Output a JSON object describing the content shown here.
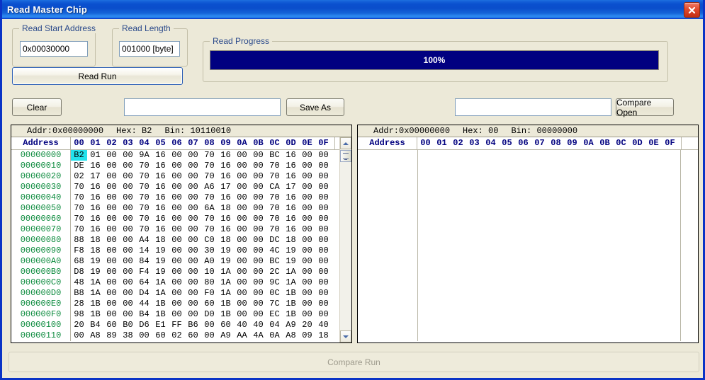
{
  "window": {
    "title": "Read Master Chip",
    "close_icon": "close-icon",
    "accent_color": "#0a50cf",
    "face_color": "#ece9d8"
  },
  "read_start_address": {
    "label": "Read Start Address",
    "value": "0x00030000",
    "placeholder": ""
  },
  "read_length": {
    "label": "Read Length",
    "value": "001000 [byte]",
    "placeholder": ""
  },
  "read_run_button": {
    "label": "Read Run"
  },
  "read_progress": {
    "label": "Read Progress",
    "percent_text": "100%",
    "percent": 100,
    "fill_color": "#000080"
  },
  "toolbar": {
    "clear_label": "Clear",
    "save_path_value": "",
    "save_path_placeholder": "",
    "save_as_label": "Save As",
    "compare_path_value": "",
    "compare_path_placeholder": "",
    "compare_open_label": "Compare Open"
  },
  "left_panel": {
    "status": {
      "addr_label": "Addr:",
      "addr_value": "0x00000000",
      "hex_label": "Hex:",
      "hex_value": "B2",
      "bin_label": "Bin:",
      "bin_value": "10110010"
    },
    "address_header": "Address",
    "byte_columns": [
      "00",
      "01",
      "02",
      "03",
      "04",
      "05",
      "06",
      "07",
      "08",
      "09",
      "0A",
      "0B",
      "0C",
      "0D",
      "0E",
      "0F"
    ],
    "selected_cell": {
      "row": 0,
      "col": 0
    },
    "rows": [
      {
        "address": "00000000",
        "bytes": [
          "B2",
          "01",
          "00",
          "00",
          "9A",
          "16",
          "00",
          "00",
          "70",
          "16",
          "00",
          "00",
          "BC",
          "16",
          "00",
          "00"
        ]
      },
      {
        "address": "00000010",
        "bytes": [
          "DE",
          "16",
          "00",
          "00",
          "70",
          "16",
          "00",
          "00",
          "70",
          "16",
          "00",
          "00",
          "70",
          "16",
          "00",
          "00"
        ]
      },
      {
        "address": "00000020",
        "bytes": [
          "02",
          "17",
          "00",
          "00",
          "70",
          "16",
          "00",
          "00",
          "70",
          "16",
          "00",
          "00",
          "70",
          "16",
          "00",
          "00"
        ]
      },
      {
        "address": "00000030",
        "bytes": [
          "70",
          "16",
          "00",
          "00",
          "70",
          "16",
          "00",
          "00",
          "A6",
          "17",
          "00",
          "00",
          "CA",
          "17",
          "00",
          "00"
        ]
      },
      {
        "address": "00000040",
        "bytes": [
          "70",
          "16",
          "00",
          "00",
          "70",
          "16",
          "00",
          "00",
          "70",
          "16",
          "00",
          "00",
          "70",
          "16",
          "00",
          "00"
        ]
      },
      {
        "address": "00000050",
        "bytes": [
          "70",
          "16",
          "00",
          "00",
          "70",
          "16",
          "00",
          "00",
          "6A",
          "18",
          "00",
          "00",
          "70",
          "16",
          "00",
          "00"
        ]
      },
      {
        "address": "00000060",
        "bytes": [
          "70",
          "16",
          "00",
          "00",
          "70",
          "16",
          "00",
          "00",
          "70",
          "16",
          "00",
          "00",
          "70",
          "16",
          "00",
          "00"
        ]
      },
      {
        "address": "00000070",
        "bytes": [
          "70",
          "16",
          "00",
          "00",
          "70",
          "16",
          "00",
          "00",
          "70",
          "16",
          "00",
          "00",
          "70",
          "16",
          "00",
          "00"
        ]
      },
      {
        "address": "00000080",
        "bytes": [
          "88",
          "18",
          "00",
          "00",
          "A4",
          "18",
          "00",
          "00",
          "C0",
          "18",
          "00",
          "00",
          "DC",
          "18",
          "00",
          "00"
        ]
      },
      {
        "address": "00000090",
        "bytes": [
          "F8",
          "18",
          "00",
          "00",
          "14",
          "19",
          "00",
          "00",
          "30",
          "19",
          "00",
          "00",
          "4C",
          "19",
          "00",
          "00"
        ]
      },
      {
        "address": "000000A0",
        "bytes": [
          "68",
          "19",
          "00",
          "00",
          "84",
          "19",
          "00",
          "00",
          "A0",
          "19",
          "00",
          "00",
          "BC",
          "19",
          "00",
          "00"
        ]
      },
      {
        "address": "000000B0",
        "bytes": [
          "D8",
          "19",
          "00",
          "00",
          "F4",
          "19",
          "00",
          "00",
          "10",
          "1A",
          "00",
          "00",
          "2C",
          "1A",
          "00",
          "00"
        ]
      },
      {
        "address": "000000C0",
        "bytes": [
          "48",
          "1A",
          "00",
          "00",
          "64",
          "1A",
          "00",
          "00",
          "80",
          "1A",
          "00",
          "00",
          "9C",
          "1A",
          "00",
          "00"
        ]
      },
      {
        "address": "000000D0",
        "bytes": [
          "B8",
          "1A",
          "00",
          "00",
          "D4",
          "1A",
          "00",
          "00",
          "F0",
          "1A",
          "00",
          "00",
          "0C",
          "1B",
          "00",
          "00"
        ]
      },
      {
        "address": "000000E0",
        "bytes": [
          "28",
          "1B",
          "00",
          "00",
          "44",
          "1B",
          "00",
          "00",
          "60",
          "1B",
          "00",
          "00",
          "7C",
          "1B",
          "00",
          "00"
        ]
      },
      {
        "address": "000000F0",
        "bytes": [
          "98",
          "1B",
          "00",
          "00",
          "B4",
          "1B",
          "00",
          "00",
          "D0",
          "1B",
          "00",
          "00",
          "EC",
          "1B",
          "00",
          "00"
        ]
      },
      {
        "address": "00000100",
        "bytes": [
          "20",
          "B4",
          "60",
          "B0",
          "D6",
          "E1",
          "FF",
          "B6",
          "00",
          "60",
          "40",
          "40",
          "04",
          "A9",
          "20",
          "40"
        ]
      },
      {
        "address": "00000110",
        "bytes": [
          "00",
          "A8",
          "89",
          "38",
          "00",
          "60",
          "02",
          "60",
          "00",
          "A9",
          "AA",
          "4A",
          "0A",
          "A8",
          "09",
          "18"
        ]
      }
    ]
  },
  "right_panel": {
    "status": {
      "addr_label": "Addr:",
      "addr_value": "0x00000000",
      "hex_label": "Hex:",
      "hex_value": "00",
      "bin_label": "Bin:",
      "bin_value": "00000000"
    },
    "address_header": "Address",
    "byte_columns": [
      "00",
      "01",
      "02",
      "03",
      "04",
      "05",
      "06",
      "07",
      "08",
      "09",
      "0A",
      "0B",
      "0C",
      "0D",
      "0E",
      "0F"
    ],
    "rows": []
  },
  "compare_run_button": {
    "label": "Compare Run",
    "enabled": false
  }
}
